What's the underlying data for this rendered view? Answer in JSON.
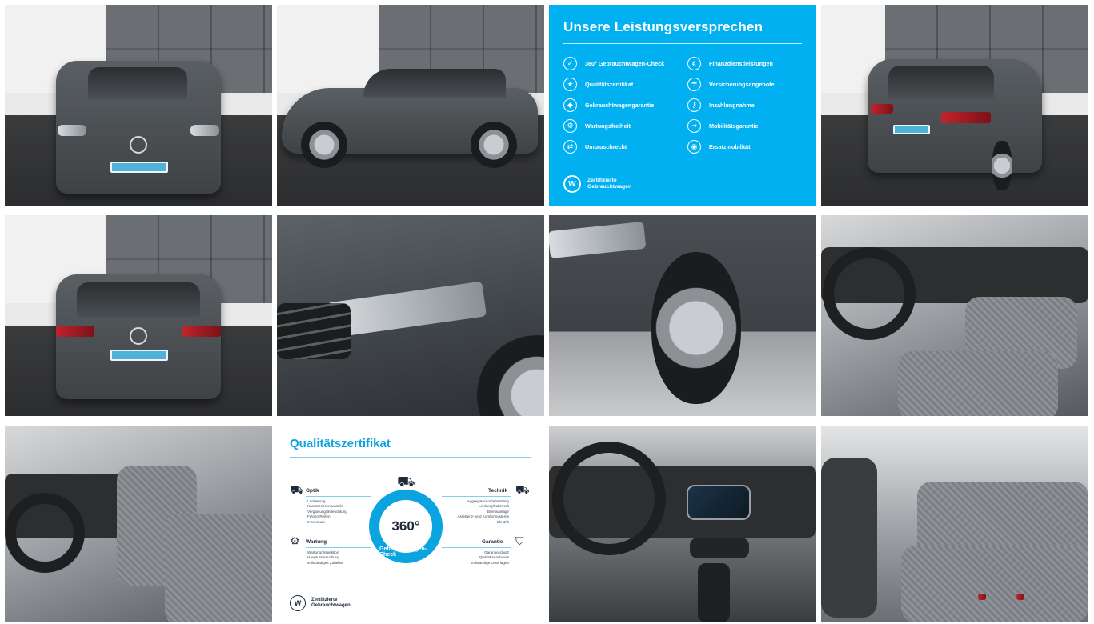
{
  "promise": {
    "title": "Unsere Leistungsversprechen",
    "left_items": [
      {
        "label": "360° Gebrauchtwagen-Check",
        "icon": "car-check-icon"
      },
      {
        "label": "Qualitätszertifikat",
        "icon": "certificate-icon"
      },
      {
        "label": "Gebrauchtwagengarantie",
        "icon": "shield-icon"
      },
      {
        "label": "Wartungsfreiheit",
        "icon": "wrench-icon"
      },
      {
        "label": "Umtauschrecht",
        "icon": "exchange-icon"
      }
    ],
    "right_items": [
      {
        "label": "Finanzdienstleistungen",
        "icon": "finance-icon"
      },
      {
        "label": "Versicherungsangebote",
        "icon": "insurance-icon"
      },
      {
        "label": "Inzahlungnahme",
        "icon": "key-icon"
      },
      {
        "label": "Mobilitätsgarantie",
        "icon": "mobility-icon"
      },
      {
        "label": "Ersatzmobilität",
        "icon": "replacement-car-icon"
      }
    ],
    "brand_line1": "Zertifizierte",
    "brand_line2": "Gebrauchtwagen"
  },
  "certificate": {
    "title": "Qualitätszertifikat",
    "sections": {
      "optik": "Optik",
      "technik": "Technik",
      "wartung": "Wartung",
      "garantie": "Garantie"
    },
    "optik_list": [
      "Lackierung",
      "Karosserie/Anbauteile",
      "Verglasung/Beleuchtung",
      "Felgen/Reifen",
      "Innenraum"
    ],
    "technik_list": [
      "Aggregate/Antriebsstrang",
      "Lenkung/Fahrwerk",
      "Bremsanlage",
      "Assistenz- und Komfortsysteme",
      "Elektrik"
    ],
    "wartung_list": [
      "Wartung/Inspektion",
      "Hauptuntersuchung",
      "vollständiges Zubehör"
    ],
    "garantie_list": [
      "Garantieschutz",
      "Qualitätsnachweis",
      "vollständige Unterlagen"
    ],
    "badge_number": "360°",
    "badge_text": "Gebrauchtwagen-Check",
    "brand_line1": "Zertifizierte",
    "brand_line2": "Gebrauchtwagen"
  },
  "photos": [
    "front-view-photo",
    "side-view-photo",
    "promise-infographic",
    "rear-three-quarter-photo",
    "rear-view-photo",
    "headlight-detail-photo",
    "wheel-detail-photo",
    "cockpit-photo",
    "front-seats-photo",
    "certificate-infographic",
    "dashboard-photo",
    "rear-seats-photo"
  ]
}
